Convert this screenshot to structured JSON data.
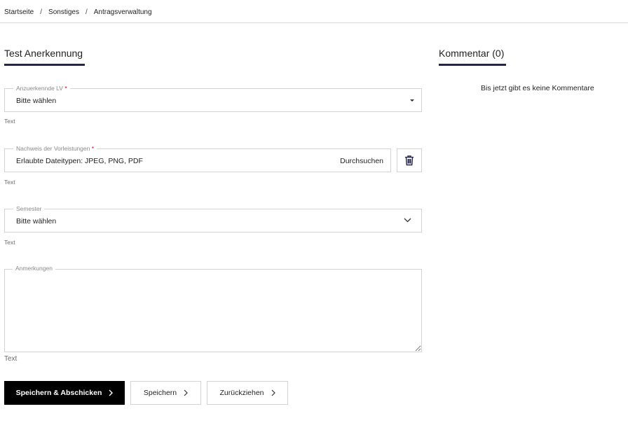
{
  "breadcrumb": {
    "items": [
      "Startseite",
      "Sonstiges",
      "Antragsverwaltung"
    ],
    "separator": "/"
  },
  "form": {
    "title": "Test Anerkennung",
    "lv": {
      "label": "Anzuerkennde LV",
      "required_mark": "*",
      "value": "Bitte wählen",
      "helper": "Text"
    },
    "proof": {
      "label": "Nachweis der Vorleistungen",
      "required_mark": "*",
      "value": "Erlaubte Dateitypen: JPEG, PNG, PDF",
      "browse_label": "Durchsuchen",
      "helper": "Text",
      "delete_icon": "trash-icon"
    },
    "semester": {
      "label": "Semester",
      "value": "Bitte wählen",
      "helper": "Text",
      "icon": "chevron-down-icon"
    },
    "notes": {
      "label": "Anmerkungen",
      "value": "",
      "helper": "Text"
    }
  },
  "actions": {
    "submit_label": "Speichern & Abschicken",
    "save_label": "Speichern",
    "withdraw_label": "Zurückziehen",
    "chevron_icon": "chevron-right-icon"
  },
  "comments": {
    "title": "Kommentar (0)",
    "empty_text": "Bis jetzt gibt es keine Kommentare"
  },
  "colors": {
    "accent_underline": "#23254a",
    "primary_button": "#000000",
    "required": "#d0021b",
    "trash_icon": "#23254a"
  }
}
